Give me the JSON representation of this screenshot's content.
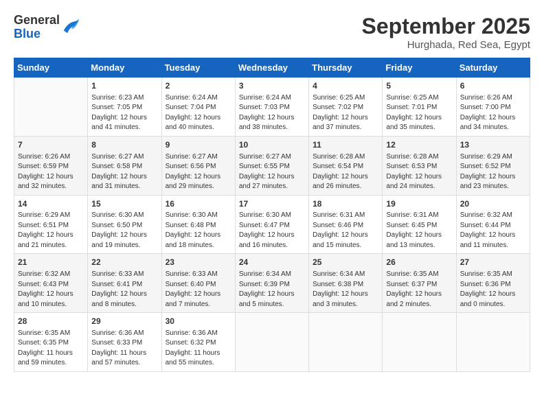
{
  "header": {
    "logo_general": "General",
    "logo_blue": "Blue",
    "month": "September 2025",
    "location": "Hurghada, Red Sea, Egypt"
  },
  "weekdays": [
    "Sunday",
    "Monday",
    "Tuesday",
    "Wednesday",
    "Thursday",
    "Friday",
    "Saturday"
  ],
  "weeks": [
    [
      {
        "day": "",
        "info": ""
      },
      {
        "day": "1",
        "info": "Sunrise: 6:23 AM\nSunset: 7:05 PM\nDaylight: 12 hours\nand 41 minutes."
      },
      {
        "day": "2",
        "info": "Sunrise: 6:24 AM\nSunset: 7:04 PM\nDaylight: 12 hours\nand 40 minutes."
      },
      {
        "day": "3",
        "info": "Sunrise: 6:24 AM\nSunset: 7:03 PM\nDaylight: 12 hours\nand 38 minutes."
      },
      {
        "day": "4",
        "info": "Sunrise: 6:25 AM\nSunset: 7:02 PM\nDaylight: 12 hours\nand 37 minutes."
      },
      {
        "day": "5",
        "info": "Sunrise: 6:25 AM\nSunset: 7:01 PM\nDaylight: 12 hours\nand 35 minutes."
      },
      {
        "day": "6",
        "info": "Sunrise: 6:26 AM\nSunset: 7:00 PM\nDaylight: 12 hours\nand 34 minutes."
      }
    ],
    [
      {
        "day": "7",
        "info": "Sunrise: 6:26 AM\nSunset: 6:59 PM\nDaylight: 12 hours\nand 32 minutes."
      },
      {
        "day": "8",
        "info": "Sunrise: 6:27 AM\nSunset: 6:58 PM\nDaylight: 12 hours\nand 31 minutes."
      },
      {
        "day": "9",
        "info": "Sunrise: 6:27 AM\nSunset: 6:56 PM\nDaylight: 12 hours\nand 29 minutes."
      },
      {
        "day": "10",
        "info": "Sunrise: 6:27 AM\nSunset: 6:55 PM\nDaylight: 12 hours\nand 27 minutes."
      },
      {
        "day": "11",
        "info": "Sunrise: 6:28 AM\nSunset: 6:54 PM\nDaylight: 12 hours\nand 26 minutes."
      },
      {
        "day": "12",
        "info": "Sunrise: 6:28 AM\nSunset: 6:53 PM\nDaylight: 12 hours\nand 24 minutes."
      },
      {
        "day": "13",
        "info": "Sunrise: 6:29 AM\nSunset: 6:52 PM\nDaylight: 12 hours\nand 23 minutes."
      }
    ],
    [
      {
        "day": "14",
        "info": "Sunrise: 6:29 AM\nSunset: 6:51 PM\nDaylight: 12 hours\nand 21 minutes."
      },
      {
        "day": "15",
        "info": "Sunrise: 6:30 AM\nSunset: 6:50 PM\nDaylight: 12 hours\nand 19 minutes."
      },
      {
        "day": "16",
        "info": "Sunrise: 6:30 AM\nSunset: 6:48 PM\nDaylight: 12 hours\nand 18 minutes."
      },
      {
        "day": "17",
        "info": "Sunrise: 6:30 AM\nSunset: 6:47 PM\nDaylight: 12 hours\nand 16 minutes."
      },
      {
        "day": "18",
        "info": "Sunrise: 6:31 AM\nSunset: 6:46 PM\nDaylight: 12 hours\nand 15 minutes."
      },
      {
        "day": "19",
        "info": "Sunrise: 6:31 AM\nSunset: 6:45 PM\nDaylight: 12 hours\nand 13 minutes."
      },
      {
        "day": "20",
        "info": "Sunrise: 6:32 AM\nSunset: 6:44 PM\nDaylight: 12 hours\nand 11 minutes."
      }
    ],
    [
      {
        "day": "21",
        "info": "Sunrise: 6:32 AM\nSunset: 6:43 PM\nDaylight: 12 hours\nand 10 minutes."
      },
      {
        "day": "22",
        "info": "Sunrise: 6:33 AM\nSunset: 6:41 PM\nDaylight: 12 hours\nand 8 minutes."
      },
      {
        "day": "23",
        "info": "Sunrise: 6:33 AM\nSunset: 6:40 PM\nDaylight: 12 hours\nand 7 minutes."
      },
      {
        "day": "24",
        "info": "Sunrise: 6:34 AM\nSunset: 6:39 PM\nDaylight: 12 hours\nand 5 minutes."
      },
      {
        "day": "25",
        "info": "Sunrise: 6:34 AM\nSunset: 6:38 PM\nDaylight: 12 hours\nand 3 minutes."
      },
      {
        "day": "26",
        "info": "Sunrise: 6:35 AM\nSunset: 6:37 PM\nDaylight: 12 hours\nand 2 minutes."
      },
      {
        "day": "27",
        "info": "Sunrise: 6:35 AM\nSunset: 6:36 PM\nDaylight: 12 hours\nand 0 minutes."
      }
    ],
    [
      {
        "day": "28",
        "info": "Sunrise: 6:35 AM\nSunset: 6:35 PM\nDaylight: 11 hours\nand 59 minutes."
      },
      {
        "day": "29",
        "info": "Sunrise: 6:36 AM\nSunset: 6:33 PM\nDaylight: 11 hours\nand 57 minutes."
      },
      {
        "day": "30",
        "info": "Sunrise: 6:36 AM\nSunset: 6:32 PM\nDaylight: 11 hours\nand 55 minutes."
      },
      {
        "day": "",
        "info": ""
      },
      {
        "day": "",
        "info": ""
      },
      {
        "day": "",
        "info": ""
      },
      {
        "day": "",
        "info": ""
      }
    ]
  ]
}
